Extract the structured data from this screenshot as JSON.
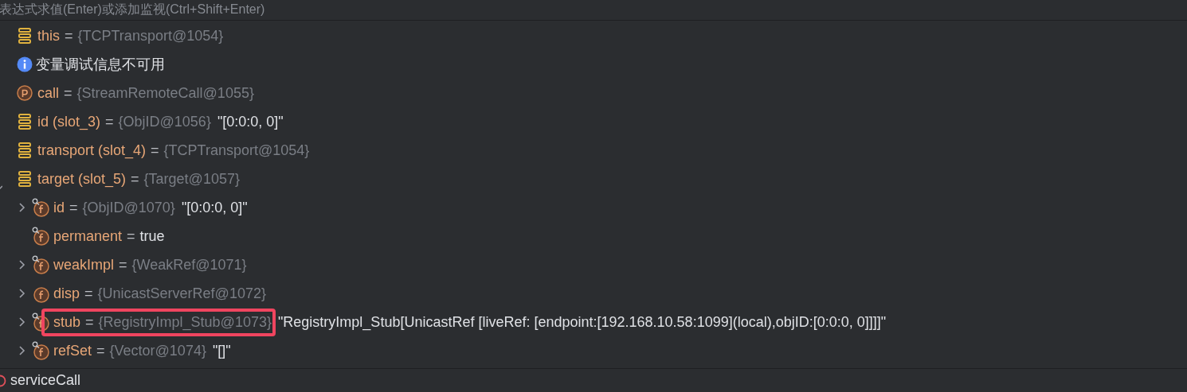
{
  "eval_field": {
    "placeholder": "表达式求值(Enter)或添加监视(Ctrl+Shift+Enter)"
  },
  "variables": [
    {
      "kind": "local",
      "name": "this",
      "separator": "=",
      "type": "{TCPTransport@1054}"
    },
    {
      "kind": "info",
      "name": "变量调试信息不可用"
    },
    {
      "kind": "param",
      "name": "call",
      "separator": "=",
      "type": "{StreamRemoteCall@1055}"
    },
    {
      "kind": "local",
      "name": "id (slot_3)",
      "separator": "=",
      "type": "{ObjID@1056}",
      "value": "\"[0:0:0, 0]\""
    },
    {
      "kind": "local",
      "name": "transport (slot_4)",
      "separator": "=",
      "type": "{TCPTransport@1054}"
    },
    {
      "kind": "local",
      "name": "target (slot_5)",
      "separator": "=",
      "type": "{Target@1057}",
      "expanded": true,
      "children": [
        {
          "kind": "field",
          "marked": true,
          "expandable": true,
          "name": "id",
          "separator": "=",
          "type": "{ObjID@1070}",
          "value": "\"[0:0:0, 0]\""
        },
        {
          "kind": "field",
          "marked": true,
          "expandable": false,
          "name": "permanent",
          "separator": "=",
          "value": "true"
        },
        {
          "kind": "field",
          "marked": true,
          "expandable": true,
          "name": "weakImpl",
          "separator": "=",
          "type": "{WeakRef@1071}"
        },
        {
          "kind": "field",
          "marked": false,
          "expandable": true,
          "name": "disp",
          "separator": "=",
          "type": "{UnicastServerRef@1072}"
        },
        {
          "kind": "field",
          "marked": true,
          "expandable": true,
          "highlighted": true,
          "name": "stub",
          "separator": "=",
          "type": "{RegistryImpl_Stub@1073}",
          "value": "\"RegistryImpl_Stub[UnicastRef [liveRef: [endpoint:[192.168.10.58:1099](local),objID:[0:0:0, 0]]]]\""
        },
        {
          "kind": "field",
          "marked": true,
          "expandable": true,
          "name": "refSet",
          "separator": "=",
          "type": "{Vector@1074}",
          "value": "\"[]\""
        }
      ]
    }
  ],
  "frame": {
    "name": "serviceCall"
  }
}
